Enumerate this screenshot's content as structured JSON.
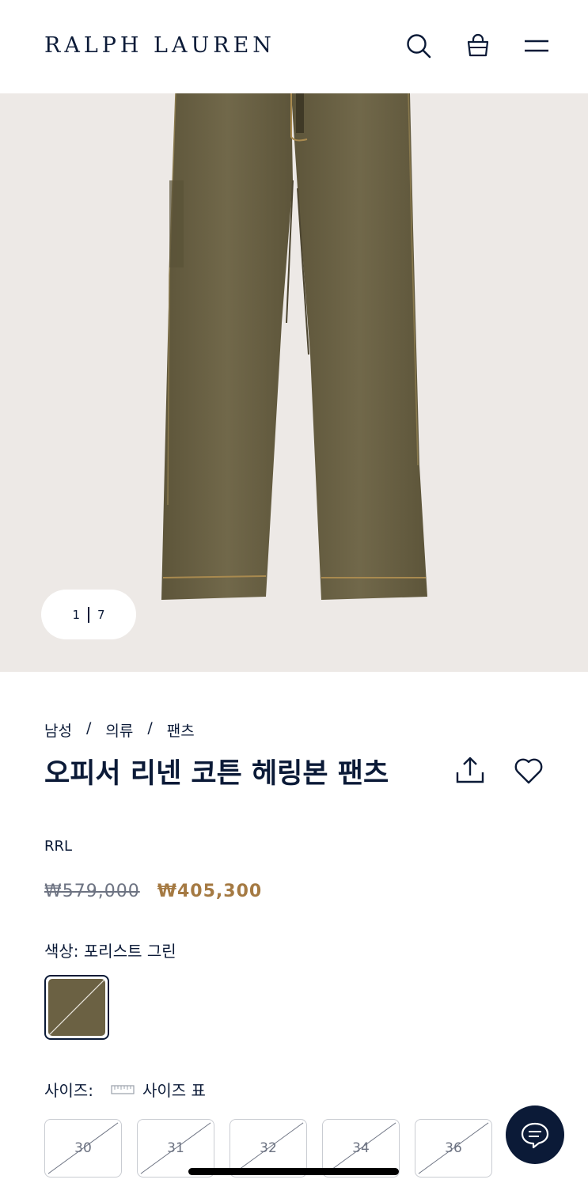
{
  "header": {
    "logo": "RALPH LAUREN",
    "icons": [
      "search-icon",
      "shopping-bag-icon",
      "menu-icon"
    ]
  },
  "gallery": {
    "current": "1",
    "total": "7"
  },
  "breadcrumb": [
    "남성",
    "의류",
    "팬츠"
  ],
  "product": {
    "title": "오피서 리넨 코튼 헤링본 팬츠",
    "brand": "RRL",
    "price_original": "₩579,000",
    "price_sale": "₩405,300",
    "color_label": "색상: 포리스트 그린",
    "swatch_color": "#6b6143"
  },
  "size": {
    "label": "사이즈:",
    "chart_label": "사이즈 표",
    "options": [
      "30",
      "31",
      "32",
      "34",
      "36"
    ]
  },
  "colors": {
    "navy": "#0b1a37",
    "sale_price": "#a57a43",
    "image_bg": "#ede9e6",
    "pants": "#6b6143"
  }
}
